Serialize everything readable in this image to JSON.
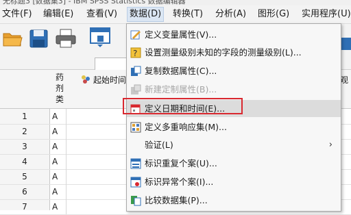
{
  "window": {
    "title": "无标题3 [数据集3] - IBM SPSS Statistics 数据编辑器"
  },
  "menubar": {
    "items": [
      {
        "label": "文件(F)"
      },
      {
        "label": "编辑(E)"
      },
      {
        "label": "查看(V)"
      },
      {
        "label": "数据(D)"
      },
      {
        "label": "转换(T)"
      },
      {
        "label": "分析(A)"
      },
      {
        "label": "图形(G)"
      },
      {
        "label": "实用程序(U)"
      }
    ]
  },
  "grid": {
    "var_header": "药剂类",
    "start_header": "起始时间",
    "right_header": "观",
    "rows": [
      {
        "num": "1",
        "value": "A"
      },
      {
        "num": "2",
        "value": "A"
      },
      {
        "num": "3",
        "value": "A"
      },
      {
        "num": "4",
        "value": "A"
      },
      {
        "num": "5",
        "value": "A"
      },
      {
        "num": "6",
        "value": "A"
      },
      {
        "num": "7",
        "value": "A"
      }
    ]
  },
  "data_menu": {
    "items": [
      {
        "label": "定义变量属性(V)...",
        "icon": "define-properties-icon",
        "disabled": false
      },
      {
        "label": "设置测量级别未知的字段的测量级别(L)...",
        "icon": "measure-level-icon",
        "disabled": false
      },
      {
        "label": "复制数据属性(C)...",
        "icon": "copy-properties-icon",
        "disabled": false
      },
      {
        "label": "新建定制属性(B)...",
        "icon": "custom-attribute-icon",
        "disabled": true
      },
      {
        "label": "定义日期和时间(E)...",
        "icon": "calendar-icon",
        "disabled": false
      },
      {
        "label": "定义多重响应集(M)...",
        "icon": "multiple-response-icon",
        "disabled": false
      },
      {
        "label": "验证(L)",
        "icon": "",
        "disabled": false
      },
      {
        "label": "标识重复个案(U)...",
        "icon": "duplicate-cases-icon",
        "disabled": false
      },
      {
        "label": "标识异常个案(I)...",
        "icon": "unusual-cases-icon",
        "disabled": false
      },
      {
        "label": "比较数据集(P)...",
        "icon": "compare-datasets-icon",
        "disabled": false
      }
    ]
  },
  "colors": {
    "highlight": "#d9282f"
  }
}
